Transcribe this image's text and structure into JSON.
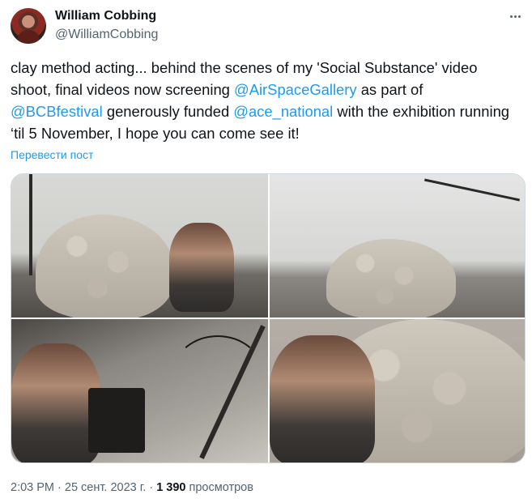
{
  "author": {
    "name": "William Cobbing",
    "handle": "@WilliamCobbing"
  },
  "tweet": {
    "text_1": "clay method acting... behind the scenes of my 'Social Substance' video shoot, final videos now screening ",
    "mention_1": "@AirSpaceGallery",
    "text_2": " as part of ",
    "mention_2": "@BCBfestival",
    "text_3": "  generously funded ",
    "mention_3": "@ace_national",
    "text_4": " with the exhibition running ‘til 5 November, I hope you can come see it!",
    "translate_label": "Перевести пост"
  },
  "meta": {
    "time": "2:03 PM",
    "separator_1": " · ",
    "date": "25 сент. 2023 г.",
    "separator_2": " · ",
    "views_count": "1 390",
    "views_label": " просмотров"
  },
  "icons": {
    "more": "more-horizontal-icon"
  },
  "colors": {
    "link": "#1d9bf0",
    "text": "#0f1419",
    "secondary": "#536471",
    "border": "#cfd9de"
  }
}
